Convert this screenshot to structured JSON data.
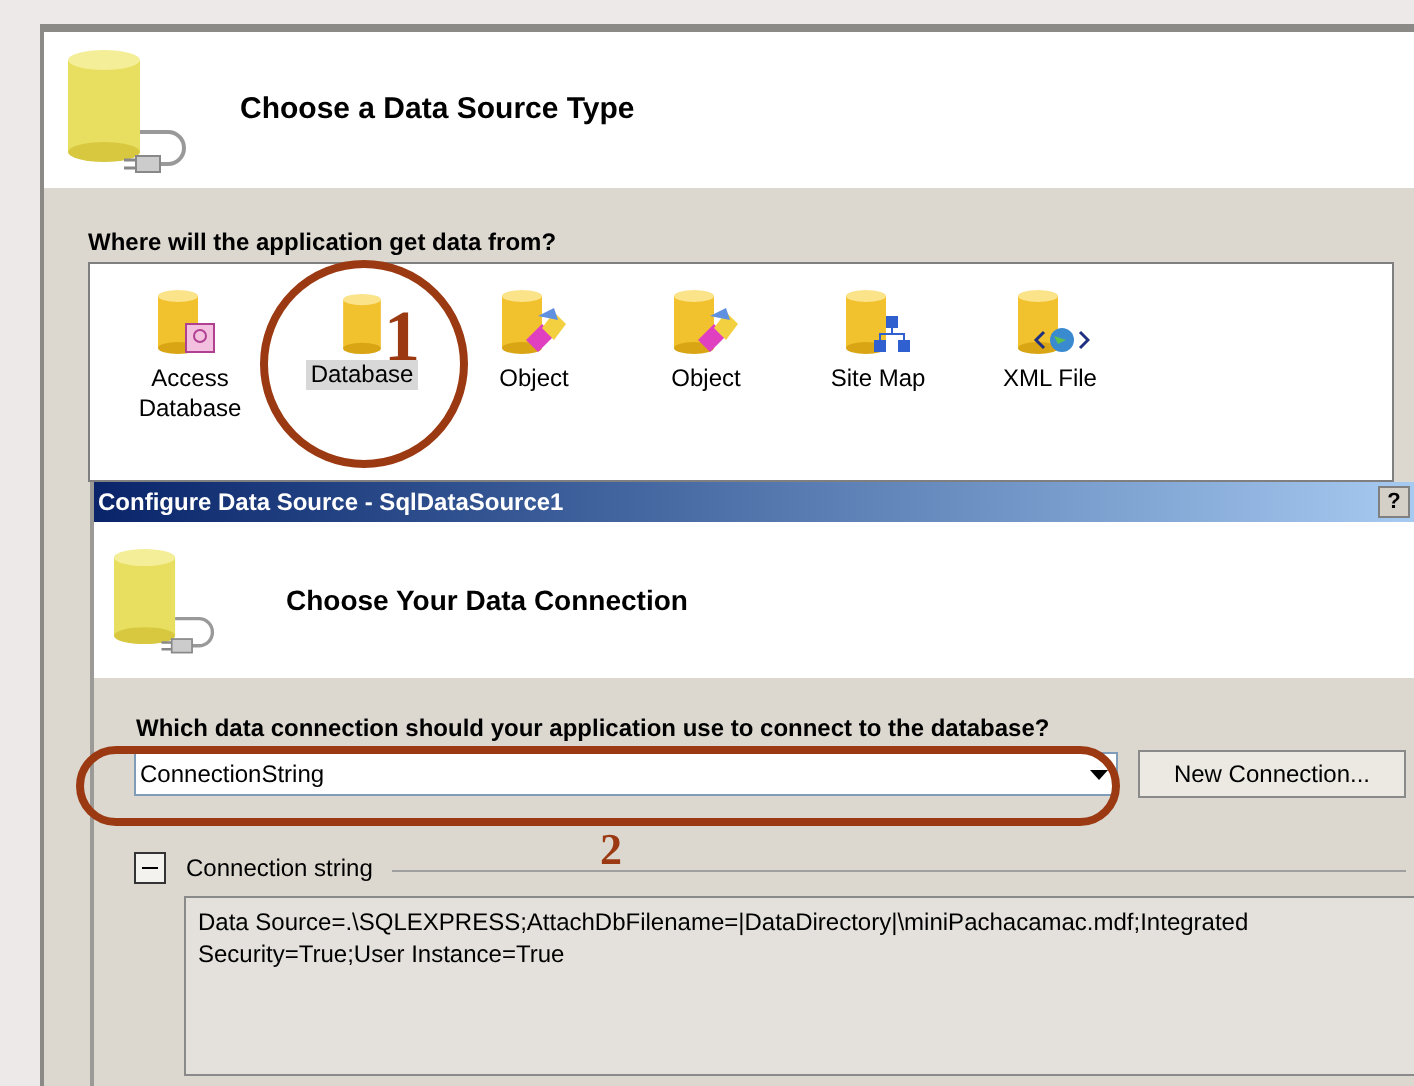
{
  "outer_dialog": {
    "title": "Choose a Data Source Type",
    "prompt": "Where will the application get data from?",
    "source_types": [
      {
        "label": "Access Database",
        "kind": "access",
        "selected": false
      },
      {
        "label": "Database",
        "kind": "database",
        "selected": true
      },
      {
        "label": "Object",
        "kind": "object",
        "selected": false
      },
      {
        "label": "Object",
        "kind": "object",
        "selected": false
      },
      {
        "label": "Site Map",
        "kind": "sitemap",
        "selected": false
      },
      {
        "label": "XML File",
        "kind": "xml",
        "selected": false
      }
    ]
  },
  "inner_dialog": {
    "title": "Configure Data Source - SqlDataSource1",
    "help_button": "?",
    "heading": "Choose Your Data Connection",
    "prompt": "Which data connection should your application use to connect to the database?",
    "connection": {
      "value": "ConnectionString"
    },
    "new_connection_button": "New Connection...",
    "connection_string": {
      "label": "Connection string",
      "expanded": true,
      "value": "Data Source=.\\SQLEXPRESS;AttachDbFilename=|DataDirectory|\\miniPachacamac.mdf;Integrated Security=True;User Instance=True"
    }
  },
  "annotations": [
    {
      "label": "1",
      "kind": "circle"
    },
    {
      "label": "2",
      "kind": "ellipse"
    }
  ]
}
